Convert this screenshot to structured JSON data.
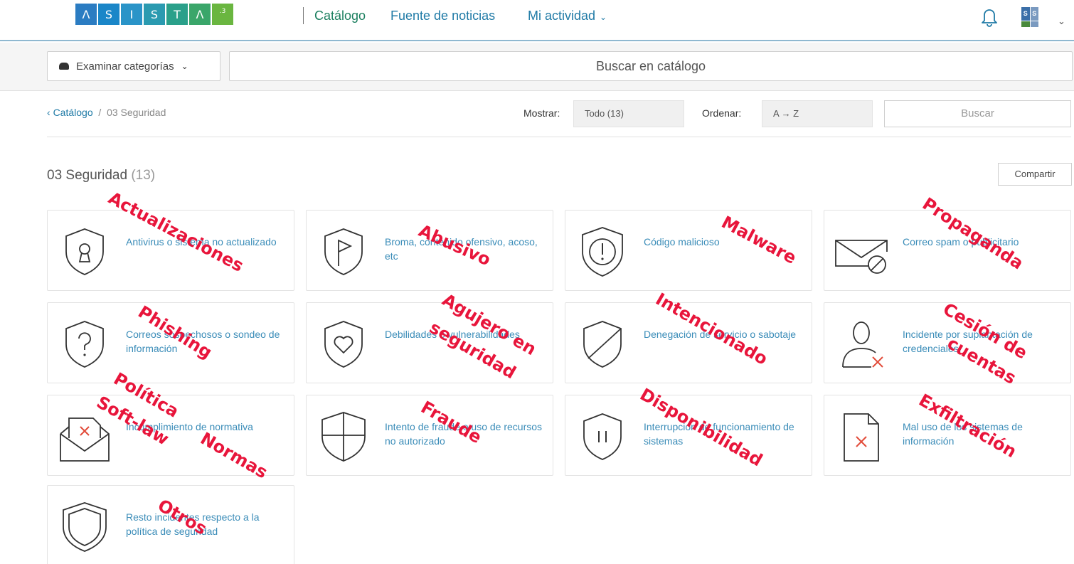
{
  "header": {
    "logo_letters": [
      "Λ",
      "S",
      "I",
      "S",
      "T",
      "Λ",
      ".3"
    ],
    "logo_colors": [
      "#2b7cc2",
      "#1a86c8",
      "#2a94c8",
      "#2a9ab0",
      "#2aa08a",
      "#3aa66a",
      "#6ab640"
    ],
    "nav_catalog": "Catálogo",
    "nav_news": "Fuente de noticias",
    "nav_activity": "Mi actividad",
    "avatar_letters": [
      "S",
      "S",
      "",
      ""
    ]
  },
  "search_band": {
    "browse_label": "Examinar categorías",
    "catalog_search_placeholder": "Buscar en catálogo"
  },
  "filters": {
    "breadcrumb_back": "Catálogo",
    "breadcrumb_sep": "/",
    "breadcrumb_current": "03 Seguridad",
    "show_label": "Mostrar:",
    "show_value": "Todo (13)",
    "order_label": "Ordenar:",
    "order_value": "A → Z",
    "search_placeholder": "Buscar"
  },
  "section": {
    "title": "03 Seguridad",
    "count": "(13)",
    "share_label": "Compartir"
  },
  "cards": [
    {
      "label": "Antivirus o sistema no actualizado",
      "icon": "shield-keyhole-icon"
    },
    {
      "label": "Broma, contenido ofensivo, acoso, etc",
      "icon": "shield-flag-icon"
    },
    {
      "label": "Código malicioso",
      "icon": "shield-exclamation-icon"
    },
    {
      "label": "Correo spam o publicitario",
      "icon": "envelope-blocked-icon"
    },
    {
      "label": "Correos sospechosos o sondeo de información",
      "icon": "shield-question-icon"
    },
    {
      "label": "Debilidades o vulnerabilidades",
      "icon": "shield-heart-icon"
    },
    {
      "label": "Denegación de servicio o sabotaje",
      "icon": "shield-slash-icon"
    },
    {
      "label": "Incidente por suplantación de credenciales.",
      "icon": "user-x-icon"
    },
    {
      "label": "Incumplimiento de normativa",
      "icon": "envelope-x-icon"
    },
    {
      "label": "Intento de fraude o uso de recursos no autorizado",
      "icon": "shield-cross-icon"
    },
    {
      "label": "Interrupción de funcionamiento de sistemas",
      "icon": "shield-pause-icon"
    },
    {
      "label": "Mal uso de los sistemas de información",
      "icon": "document-x-icon"
    },
    {
      "label": "Resto incidentes respecto a la política de seguridad",
      "icon": "shield-outline-icon"
    }
  ],
  "annotations": [
    "Actualizaciones",
    "Abusivo",
    "Malware",
    "Propaganda",
    "Phishing",
    "Agujero en",
    "seguridad",
    "Intencionado",
    "Cesión de",
    "cuentas",
    "Política",
    "Normas",
    "Soft-law",
    "Fraude",
    "Disponibilidad",
    "Exfiltración",
    "Otros"
  ],
  "colors": {
    "brand_green": "#1b7f5f",
    "link_blue": "#1f7aa6",
    "card_text": "#3a8cb8",
    "annotation_red": "#e8153b"
  }
}
